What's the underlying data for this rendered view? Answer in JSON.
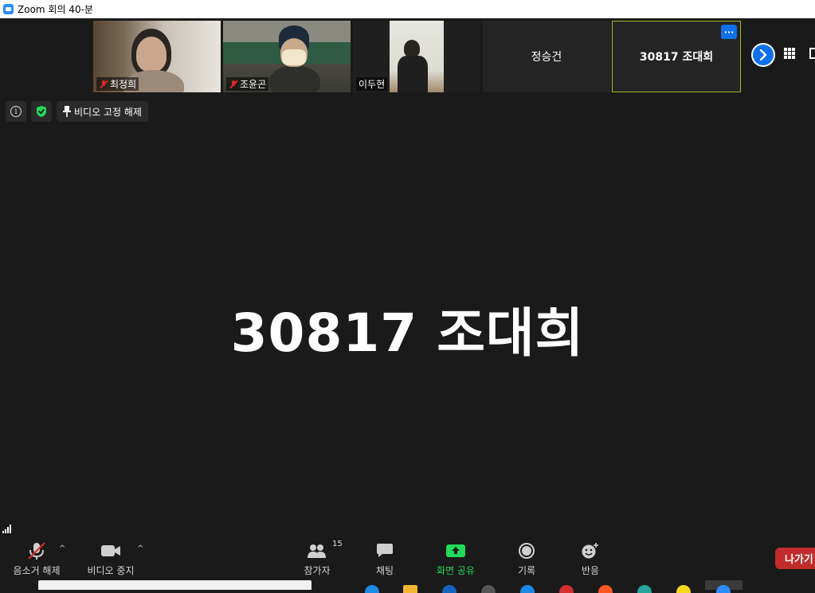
{
  "window": {
    "title": "Zoom 회의 40-분"
  },
  "participants": [
    {
      "name": "최정희",
      "muted": true
    },
    {
      "name": "조윤곤",
      "muted": true
    },
    {
      "name": "이두현",
      "muted": false
    },
    {
      "name": "정승건"
    },
    {
      "name": "30817 조대희",
      "active": true
    }
  ],
  "tile_more_label": "···",
  "top_controls": {
    "unpin_label": "비디오 고정 해제"
  },
  "speaker": {
    "name": "30817 조대희"
  },
  "toolbar": {
    "mute_label": "음소거 해제",
    "video_label": "비디오 중지",
    "participants_label": "참가자",
    "participants_count": "15",
    "chat_label": "채팅",
    "share_label": "화면 공유",
    "record_label": "기록",
    "reactions_label": "반응",
    "leave_label": "나가기",
    "caret": "^"
  },
  "colors": {
    "accent_blue": "#0e71eb",
    "share_green": "#23d959",
    "leave_red": "#c02b2b",
    "active_border": "#a4b82a"
  }
}
